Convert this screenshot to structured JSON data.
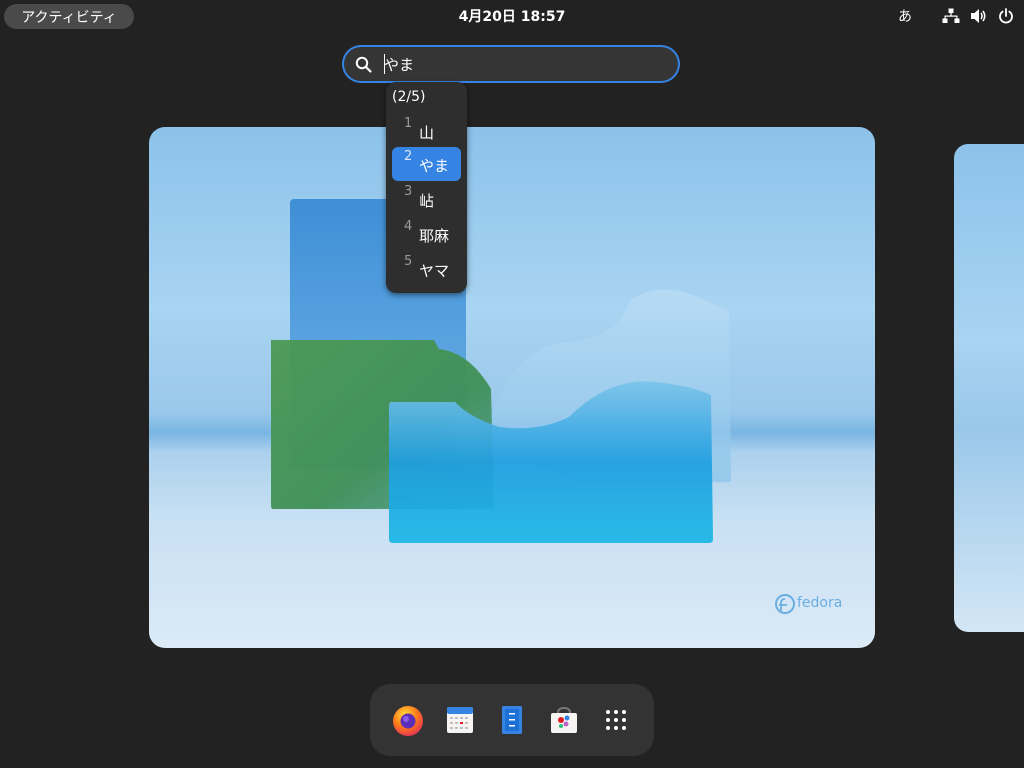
{
  "topbar": {
    "activities_label": "アクティビティ",
    "clock": "4月20日  18:57",
    "input_method": "あ",
    "icons": [
      "network-wired-icon",
      "volume-icon",
      "power-icon"
    ]
  },
  "search": {
    "value": "やま"
  },
  "ime": {
    "page_indicator": "(2/5)",
    "selected_index": 2,
    "candidates": [
      {
        "number": "1",
        "text": "山"
      },
      {
        "number": "2",
        "text": "やま"
      },
      {
        "number": "3",
        "text": "岾"
      },
      {
        "number": "4",
        "text": "耶麻"
      },
      {
        "number": "5",
        "text": "ヤマ"
      }
    ]
  },
  "wallpaper": {
    "logo_text": "fedora"
  },
  "dash": {
    "apps": [
      "firefox-icon",
      "calendar-icon",
      "text-editor-icon",
      "software-icon",
      "show-apps-icon"
    ]
  },
  "colors": {
    "accent": "#3584e4",
    "panel": "#222222",
    "popup": "#2e2e2e",
    "dash": "#333333"
  }
}
